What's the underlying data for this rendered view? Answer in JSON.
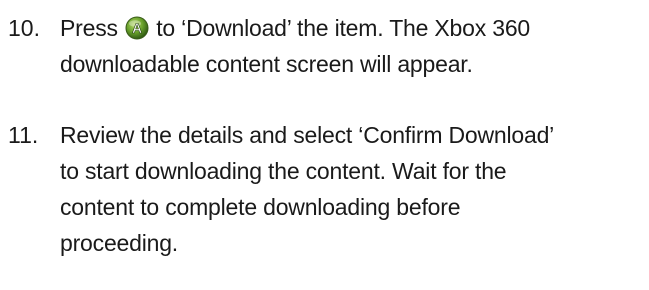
{
  "steps": [
    {
      "number": "10.",
      "lines": [
        [
          "Press",
          "to ‘Download’ the item.  The Xbox 360"
        ],
        "downloadable content screen will appear."
      ],
      "button_icon": "xbox-a-button-icon",
      "button_letter": "A",
      "button_color": "#6aa22c"
    },
    {
      "number": "11.",
      "lines": [
        "Review the details and select ‘Confirm Download’",
        "to start downloading the content.  Wait for the",
        "content to complete downloading before",
        "proceeding."
      ]
    }
  ]
}
